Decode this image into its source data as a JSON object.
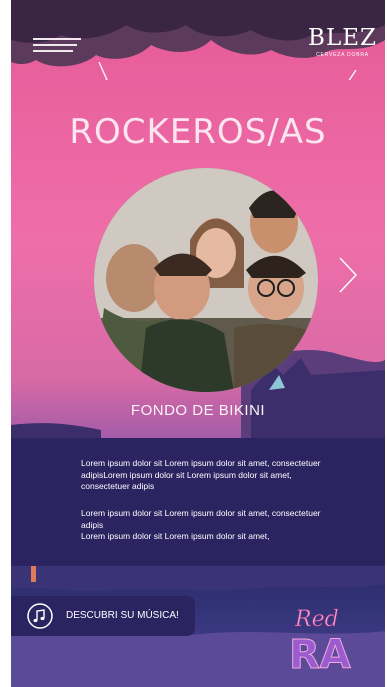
{
  "header": {
    "menu_icon": "hamburger-menu-icon",
    "brand_name": "BLEZ",
    "brand_tagline": "CERVEZA DOBRA"
  },
  "hero": {
    "title": "ROCKEROS/AS",
    "band_name": "FONDO DE BIKINI",
    "next_icon": "chevron-right-icon"
  },
  "description": {
    "paragraph1": "Lorem ipsum dolor sit Lorem ipsum dolor sit amet, consectetuer adipisLorem ipsum dolor sit Lorem ipsum dolor sit amet, consectetuer adipis",
    "paragraph2_line1": "Lorem ipsum dolor sit Lorem ipsum dolor sit amet, consectetuer adipis",
    "paragraph2_line2": "Lorem ipsum dolor sit Lorem ipsum dolor sit amet,"
  },
  "cta": {
    "label": "DESCUBRI SU MÚSICA!",
    "icon": "music-note-icon"
  },
  "badge": {
    "script_text": "Red",
    "block_text": "RA"
  },
  "colors": {
    "pink": "#ee6ea9",
    "navy": "#2c2361",
    "accent_purple": "#7a4bb0"
  }
}
